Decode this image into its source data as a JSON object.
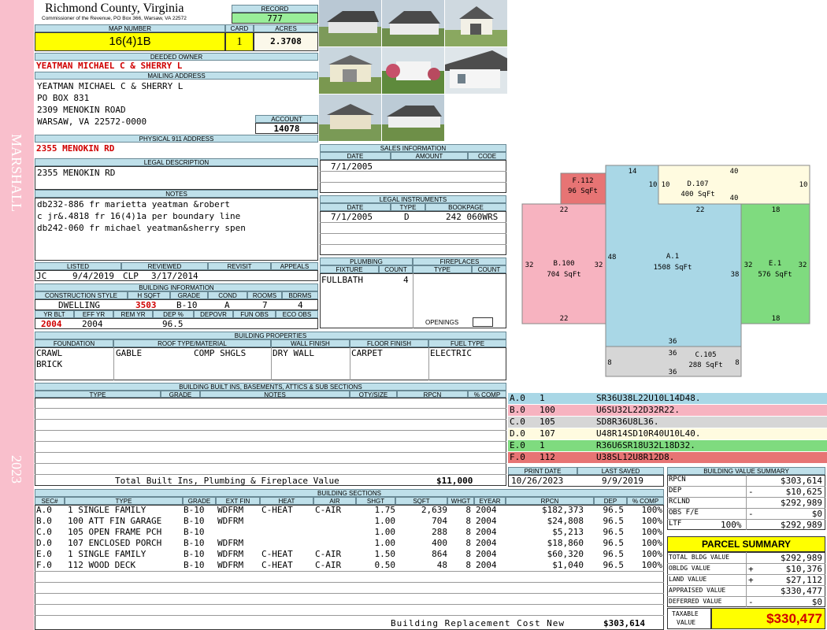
{
  "sidebar": {
    "district": "MARSHALL",
    "year": "2023"
  },
  "header": {
    "county": "Richmond County, Virginia",
    "commissioner": "Commissioner of the Revenue, PO Box 366, Warsaw, VA 22572",
    "record_label": "RECORD",
    "record": "777",
    "map_label": "MAP NUMBER",
    "map_number": "16(4)1B",
    "card_label": "CARD",
    "card": "1",
    "acres_label": "ACRES",
    "acres": "2.3708"
  },
  "owner": {
    "label": "DEEDED OWNER",
    "name": "YEATMAN MICHAEL C & SHERRY L",
    "mailing_label": "MAILING ADDRESS",
    "mailing": [
      "YEATMAN MICHAEL C & SHERRY L",
      "PO BOX 831",
      "2309 MENOKIN ROAD",
      "WARSAW, VA 22572-0000"
    ],
    "account_label": "ACCOUNT",
    "account": "14078",
    "physical_label": "PHYSICAL 911 ADDRESS",
    "physical": "2355 MENOKIN RD"
  },
  "legal": {
    "label": "LEGAL DESCRIPTION",
    "text": "2355 MENOKIN RD"
  },
  "notes": {
    "label": "NOTES",
    "lines": [
      "db232-886 fr marietta yeatman &robert",
      "c jr&.4818 fr 16(4)1a per boundary line",
      "db242-060 fr michael yeatman&sherry spen"
    ]
  },
  "listing": {
    "listed_label": "LISTED",
    "reviewed_label": "REVIEWED",
    "revisit_label": "REVISIT",
    "appeals_label": "APPEALS",
    "listed_by": "JC",
    "listed_date": "9/4/2019",
    "reviewed_by": "CLP",
    "reviewed_date": "3/17/2014"
  },
  "building_info": {
    "label": "BUILDING INFORMATION",
    "h_style": "CONSTRUCTION STYLE",
    "h_hsqft": "H SQFT",
    "h_grade": "GRADE",
    "h_cond": "COND",
    "h_rooms": "ROOMS",
    "h_bdrms": "BDRMS",
    "style": "DWELLING",
    "hsqft": "3503",
    "grade": "B-10",
    "cond": "A",
    "rooms": "7",
    "bdrms": "4",
    "h_yrblt": "YR BLT",
    "h_effyr": "EFF YR",
    "h_remyr": "REM YR",
    "h_dep": "DEP %",
    "h_depovr": "DEPOVR",
    "h_funobs": "FUN OBS",
    "h_ecoobs": "ECO OBS",
    "yrblt": "2004",
    "effyr": "2004",
    "dep": "96.5"
  },
  "sales": {
    "label": "SALES INFORMATION",
    "h_date": "DATE",
    "h_amount": "AMOUNT",
    "h_code": "CODE",
    "date": "7/1/2005"
  },
  "instruments": {
    "label": "LEGAL INSTRUMENTS",
    "h_date": "DATE",
    "h_type": "TYPE",
    "h_bookpage": "BOOKPAGE",
    "date": "7/1/2005",
    "type": "D",
    "bookpage": "242 060WRS"
  },
  "plumbing": {
    "label": "PLUMBING",
    "h_fixture": "FIXTURE",
    "h_count": "COUNT",
    "fixture": "FULLBATH",
    "count": "4"
  },
  "fireplaces": {
    "label": "FIREPLACES",
    "h_type": "TYPE",
    "h_count": "COUNT",
    "openings": "OPENINGS"
  },
  "properties": {
    "label": "BUILDING PROPERTIES",
    "h_found": "FOUNDATION",
    "h_roof": "ROOF TYPE/MATERIAL",
    "h_wall": "WALL FINISH",
    "h_floor": "FLOOR FINISH",
    "h_fuel": "FUEL TYPE",
    "found1": "CRAWL",
    "found2": "BRICK",
    "roof_type": "GABLE",
    "roof_mat": "COMP SHGLS",
    "wall": "DRY WALL",
    "floor": "CARPET",
    "fuel": "ELECTRIC"
  },
  "builtins": {
    "label": "BUILDING BUILT INS, BASEMENTS, ATTICS & SUB SECTIONS",
    "h_type": "TYPE",
    "h_grade": "GRADE",
    "h_notes": "NOTES",
    "h_qty": "QTY/SIZE",
    "h_rpcn": "RPCN",
    "h_comp": "% COMP",
    "total_label": "Total Built Ins, Plumbing & Fireplace Value",
    "total": "$11,000"
  },
  "sketch": {
    "areas": [
      {
        "code": "F.112",
        "sqft": "96 SqFt",
        "color": "#e77474"
      },
      {
        "code": "D.107",
        "sqft": "400 SqFt",
        "color": "#fffbe0"
      },
      {
        "code": "B.100",
        "sqft": "704 SqFt",
        "color": "#f7b3c0"
      },
      {
        "code": "A.1",
        "sqft": "1508 SqFt",
        "color": "#a9d7e6"
      },
      {
        "code": "E.1",
        "sqft": "576 SqFt",
        "color": "#7fdb7f"
      },
      {
        "code": "C.105",
        "sqft": "288 SqFt",
        "color": "#d6d6d6"
      }
    ],
    "dims": [
      "14",
      "40",
      "10",
      "10",
      "10",
      "40",
      "22",
      "22",
      "18",
      "32",
      "32",
      "48",
      "38",
      "32",
      "32",
      "22",
      "18",
      "36",
      "36",
      "8",
      "8",
      "36"
    ]
  },
  "traverse": [
    {
      "sec": "A.0",
      "code": "1",
      "desc": "SR36U38L22U10L14D48.",
      "color": "#a9d7e6"
    },
    {
      "sec": "B.0",
      "code": "100",
      "desc": "U6SU32L22D32R22.",
      "color": "#f7b3c0"
    },
    {
      "sec": "C.0",
      "code": "105",
      "desc": "SD8R36U8L36.",
      "color": "#d6d6d6"
    },
    {
      "sec": "D.0",
      "code": "107",
      "desc": "U48R14SD10R40U10L40.",
      "color": "#fffbe0"
    },
    {
      "sec": "E.0",
      "code": "1",
      "desc": "R36U6SR18U32L18D32.",
      "color": "#7fdb7f"
    },
    {
      "sec": "F.0",
      "code": "112",
      "desc": "U38SL12U8R12D8.",
      "color": "#e77474"
    }
  ],
  "dates": {
    "print_label": "PRINT DATE",
    "print": "10/26/2023",
    "saved_label": "LAST SAVED",
    "saved": "9/9/2019"
  },
  "value_summary": {
    "label": "BUILDING VALUE SUMMARY",
    "rpcn_l": "RPCN",
    "rpcn": "$303,614",
    "dep_l": "DEP",
    "dep_s": "-",
    "dep": "$10,625",
    "rclnd_l": "RCLND",
    "rclnd": "$292,989",
    "obs_l": "OBS F/E",
    "obs_s": "-",
    "obs": "$0",
    "ltr_l": "LTF",
    "ltr_pct": "100%",
    "ltr": "$292,989"
  },
  "parcel": {
    "label": "PARCEL SUMMARY",
    "tbv_l": "TOTAL BLDG VALUE",
    "tbv": "$292,989",
    "oblgd_l": "OBLDG VALUE",
    "oblgd_s": "+",
    "oblgd": "$10,376",
    "land_l": "LAND VALUE",
    "land_s": "+",
    "land": "$27,112",
    "appr_l": "APPRAISED VALUE",
    "appr": "$330,477",
    "def_l": "DEFERRED VALUE",
    "def_s": "-",
    "def": "$0",
    "tax_l1": "TAXABLE",
    "tax_l2": "VALUE",
    "tax": "$330,477"
  },
  "sections": {
    "label": "BUILDING SECTIONS",
    "headers": [
      "SEC#",
      "TYPE",
      "GRADE",
      "EXT FIN",
      "HEAT",
      "AIR",
      "SHGT",
      "SQFT",
      "WHGT",
      "EYEAR",
      "RPCN",
      "DEP",
      "% COMP"
    ],
    "rows": [
      [
        "A.0",
        "1 SINGLE FAMILY",
        "B-10",
        "WDFRM",
        "C-HEAT",
        "C-AIR",
        "1.75",
        "2,639",
        "8",
        "2004",
        "$182,373",
        "96.5",
        "100%"
      ],
      [
        "B.0",
        "100 ATT FIN GARAGE",
        "B-10",
        "WDFRM",
        "",
        "",
        "1.00",
        "704",
        "8",
        "2004",
        "$24,808",
        "96.5",
        "100%"
      ],
      [
        "C.0",
        "105 OPEN FRAME PCH",
        "B-10",
        "",
        "",
        "",
        "1.00",
        "288",
        "8",
        "2004",
        "$5,213",
        "96.5",
        "100%"
      ],
      [
        "D.0",
        "107 ENCLOSED PORCH",
        "B-10",
        "WDFRM",
        "",
        "",
        "1.00",
        "400",
        "8",
        "2004",
        "$18,860",
        "96.5",
        "100%"
      ],
      [
        "E.0",
        "1 SINGLE FAMILY",
        "B-10",
        "WDFRM",
        "C-HEAT",
        "C-AIR",
        "1.50",
        "864",
        "8",
        "2004",
        "$60,320",
        "96.5",
        "100%"
      ],
      [
        "F.0",
        "112 WOOD DECK",
        "B-10",
        "WDFRM",
        "C-HEAT",
        "C-AIR",
        "0.50",
        "48",
        "8",
        "2004",
        "$1,040",
        "96.5",
        "100%"
      ]
    ],
    "total_label": "Building Replacement Cost New",
    "total": "$303,614"
  }
}
